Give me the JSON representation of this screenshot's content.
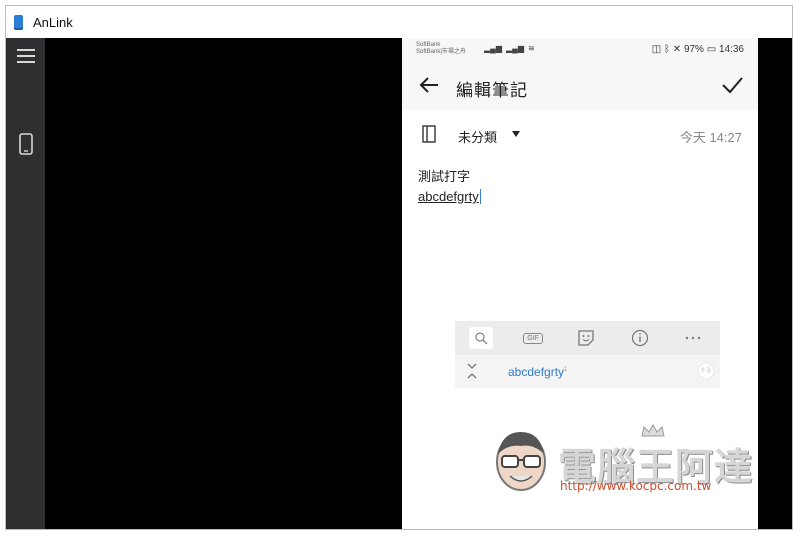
{
  "window": {
    "title": "AnLink",
    "icon": "phone-app-icon"
  },
  "sidebar": {
    "items": [
      {
        "icon": "hamburger-menu-icon"
      },
      {
        "icon": "phone-icon"
      }
    ]
  },
  "phone": {
    "statusbar": {
      "carrier_line1": "SoftBank",
      "carrier_line2": "SoftBank|市場之舟",
      "signal": "4G",
      "right_text": "97% 14:36",
      "battery": "97%",
      "time": "14:36"
    },
    "appbar": {
      "title": "編輯筆記"
    },
    "meta": {
      "category": "未分類",
      "timestamp": "今天 14:27"
    },
    "note": {
      "title": "測試打字",
      "body": "abcdefgrty"
    },
    "keyboard": {
      "tools": [
        "search-icon",
        "gif-icon",
        "sticker-icon",
        "info-icon",
        "more-icon"
      ],
      "gif_label": "GIF",
      "suggestion": "abcdefgrty",
      "suggestion_sup": "1"
    },
    "watermark": {
      "name": "電腦王阿達",
      "url": "http://www.kocpc.com.tw"
    }
  },
  "colors": {
    "accent": "#2f7bc8",
    "sidebar": "#2f2f31",
    "viewport": "#000000"
  }
}
